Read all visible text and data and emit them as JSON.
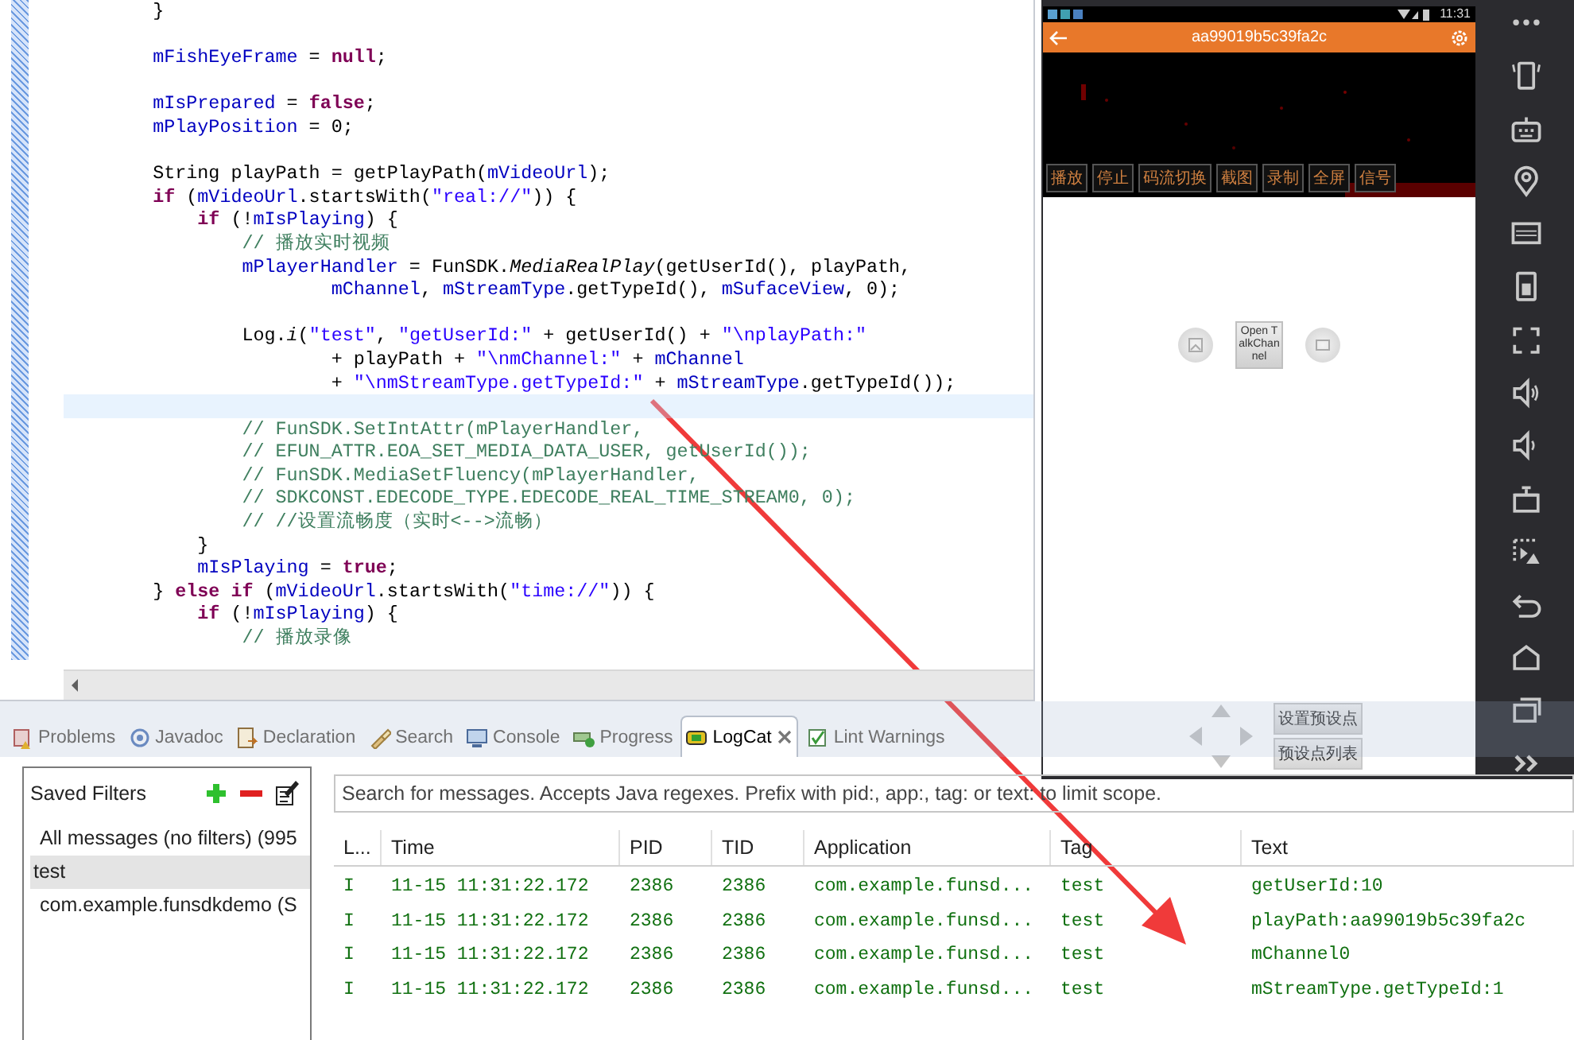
{
  "editor": {
    "lines": [
      {
        "current": false,
        "segments": [
          {
            "kind": "plain",
            "text": "        }"
          }
        ]
      },
      {
        "current": false
      },
      {
        "current": false,
        "segments": [
          {
            "kind": "field",
            "text": "        mFishEyeFrame"
          },
          {
            "kind": "plain",
            "text": " = "
          },
          {
            "kind": "keyword",
            "text": "null"
          },
          {
            "kind": "plain",
            "text": ";"
          }
        ]
      },
      {
        "current": false
      },
      {
        "current": false,
        "segments": [
          {
            "kind": "field",
            "text": "        mIsPrepared"
          },
          {
            "kind": "plain",
            "text": " = "
          },
          {
            "kind": "keyword",
            "text": "false"
          },
          {
            "kind": "plain",
            "text": ";"
          }
        ]
      },
      {
        "current": false,
        "segments": [
          {
            "kind": "field",
            "text": "        mPlayPosition"
          },
          {
            "kind": "plain",
            "text": " = 0;"
          }
        ]
      },
      {
        "current": false
      },
      {
        "current": false,
        "segments": [
          {
            "kind": "plain",
            "text": "        String playPath = getPlayPath("
          },
          {
            "kind": "field",
            "text": "mVideoUrl"
          },
          {
            "kind": "plain",
            "text": ");"
          }
        ]
      },
      {
        "current": false,
        "segments": [
          {
            "kind": "keyword",
            "text": "        if"
          },
          {
            "kind": "plain",
            "text": " ("
          },
          {
            "kind": "field",
            "text": "mVideoUrl"
          },
          {
            "kind": "plain",
            "text": ".startsWith("
          },
          {
            "kind": "string",
            "text": "\"real://\""
          },
          {
            "kind": "plain",
            "text": ")) {"
          }
        ]
      },
      {
        "current": false,
        "segments": [
          {
            "kind": "keyword",
            "text": "            if"
          },
          {
            "kind": "plain",
            "text": " (!"
          },
          {
            "kind": "field",
            "text": "mIsPlaying"
          },
          {
            "kind": "plain",
            "text": ") {"
          }
        ]
      },
      {
        "current": false,
        "segments": [
          {
            "kind": "comment",
            "text": "                // 播放实时视频"
          }
        ]
      },
      {
        "current": false,
        "segments": [
          {
            "kind": "field",
            "text": "                mPlayerHandler"
          },
          {
            "kind": "plain",
            "text": " = FunSDK."
          },
          {
            "kind": "italic",
            "text": "MediaRealPlay"
          },
          {
            "kind": "plain",
            "text": "(getUserId(), playPath,"
          }
        ]
      },
      {
        "current": false,
        "segments": [
          {
            "kind": "field",
            "text": "                        mChannel"
          },
          {
            "kind": "plain",
            "text": ", "
          },
          {
            "kind": "field",
            "text": "mStreamType"
          },
          {
            "kind": "plain",
            "text": ".getTypeId(), "
          },
          {
            "kind": "field",
            "text": "mSufaceView"
          },
          {
            "kind": "plain",
            "text": ", 0);"
          }
        ]
      },
      {
        "current": false
      },
      {
        "current": false,
        "segments": [
          {
            "kind": "plain",
            "text": "                Log."
          },
          {
            "kind": "italic",
            "text": "i"
          },
          {
            "kind": "plain",
            "text": "("
          },
          {
            "kind": "string",
            "text": "\"test\""
          },
          {
            "kind": "plain",
            "text": ", "
          },
          {
            "kind": "string",
            "text": "\"getUserId:\""
          },
          {
            "kind": "plain",
            "text": " + getUserId() + "
          },
          {
            "kind": "string",
            "text": "\"\\nplayPath:\""
          }
        ]
      },
      {
        "current": false,
        "segments": [
          {
            "kind": "plain",
            "text": "                        + playPath + "
          },
          {
            "kind": "string",
            "text": "\"\\nmChannel:\""
          },
          {
            "kind": "plain",
            "text": " + "
          },
          {
            "kind": "field",
            "text": "mChannel"
          }
        ]
      },
      {
        "current": false,
        "segments": [
          {
            "kind": "plain",
            "text": "                        + "
          },
          {
            "kind": "string",
            "text": "\"\\nmStreamType.getTypeId:\""
          },
          {
            "kind": "plain",
            "text": " + "
          },
          {
            "kind": "field",
            "text": "mStreamType"
          },
          {
            "kind": "plain",
            "text": ".getTypeId());"
          }
        ]
      },
      {
        "current": true
      },
      {
        "current": false,
        "segments": [
          {
            "kind": "comment",
            "text": "                // FunSDK.SetIntAttr(mPlayerHandler,"
          }
        ]
      },
      {
        "current": false,
        "segments": [
          {
            "kind": "comment",
            "text": "                // EFUN_ATTR.EOA_SET_MEDIA_DATA_USER, getUserId());"
          }
        ]
      },
      {
        "current": false,
        "segments": [
          {
            "kind": "comment",
            "text": "                // FunSDK.MediaSetFluency(mPlayerHandler,"
          }
        ]
      },
      {
        "current": false,
        "segments": [
          {
            "kind": "comment",
            "text": "                // SDKCONST.EDECODE_TYPE.EDECODE_REAL_TIME_STREAM0, 0);"
          }
        ]
      },
      {
        "current": false,
        "segments": [
          {
            "kind": "comment",
            "text": "                // //设置流畅度（实时<-->流畅）"
          }
        ]
      },
      {
        "current": false,
        "segments": [
          {
            "kind": "plain",
            "text": "            }"
          }
        ]
      },
      {
        "current": false,
        "segments": [
          {
            "kind": "field",
            "text": "            mIsPlaying"
          },
          {
            "kind": "plain",
            "text": " = "
          },
          {
            "kind": "keyword",
            "text": "true"
          },
          {
            "kind": "plain",
            "text": ";"
          }
        ]
      },
      {
        "current": false,
        "segments": [
          {
            "kind": "plain",
            "text": "        } "
          },
          {
            "kind": "keyword",
            "text": "else if"
          },
          {
            "kind": "plain",
            "text": " ("
          },
          {
            "kind": "field",
            "text": "mVideoUrl"
          },
          {
            "kind": "plain",
            "text": ".startsWith("
          },
          {
            "kind": "string",
            "text": "\"time://\""
          },
          {
            "kind": "plain",
            "text": ")) {"
          }
        ]
      },
      {
        "current": false,
        "segments": [
          {
            "kind": "keyword",
            "text": "            if"
          },
          {
            "kind": "plain",
            "text": " (!"
          },
          {
            "kind": "field",
            "text": "mIsPlaying"
          },
          {
            "kind": "plain",
            "text": ") {"
          }
        ]
      },
      {
        "current": false,
        "segments": [
          {
            "kind": "comment",
            "text": "                // 播放录像"
          }
        ]
      }
    ]
  },
  "emulator": {
    "status_time": "11:31",
    "title": "aa99019b5c39fa2c",
    "video_buttons": [
      "播放",
      "停止",
      "码流切换",
      "截图",
      "录制",
      "全屏",
      "信号"
    ],
    "talk_button": "Open TalkChannel",
    "preset_buttons": [
      "设置预设点",
      "预设点列表"
    ]
  },
  "bottom_tabs": [
    {
      "label": "Problems",
      "selected": false
    },
    {
      "label": "Javadoc",
      "selected": false
    },
    {
      "label": "Declaration",
      "selected": false
    },
    {
      "label": "Search",
      "selected": false
    },
    {
      "label": "Console",
      "selected": false
    },
    {
      "label": "Progress",
      "selected": false
    },
    {
      "label": "LogCat",
      "selected": true
    },
    {
      "label": "Lint Warnings",
      "selected": false
    }
  ],
  "saved_filters": {
    "title": "Saved Filters",
    "items": [
      {
        "label": "All messages (no filters) (995",
        "selected": false
      },
      {
        "label": "test",
        "selected": true
      },
      {
        "label": "com.example.funsdkdemo (S",
        "selected": false
      }
    ]
  },
  "logcat": {
    "search": {
      "placeholder": "Search for messages. Accepts Java regexes. Prefix with pid:, app:, tag: or text: to limit scope."
    },
    "columns": [
      "L...",
      "Time",
      "PID",
      "TID",
      "Application",
      "Tag",
      "Text"
    ],
    "rows": [
      [
        "I",
        "11-15 11:31:22.172",
        "2386",
        "2386",
        "com.example.funsd...",
        "test",
        "getUserId:10"
      ],
      [
        "I",
        "11-15 11:31:22.172",
        "2386",
        "2386",
        "com.example.funsd...",
        "test",
        "playPath:aa99019b5c39fa2c"
      ],
      [
        "I",
        "11-15 11:31:22.172",
        "2386",
        "2386",
        "com.example.funsd...",
        "test",
        "mChannel0"
      ],
      [
        "I",
        "11-15 11:31:22.172",
        "2386",
        "2386",
        "com.example.funsd...",
        "test",
        "mStreamType.getTypeId:1"
      ]
    ]
  }
}
